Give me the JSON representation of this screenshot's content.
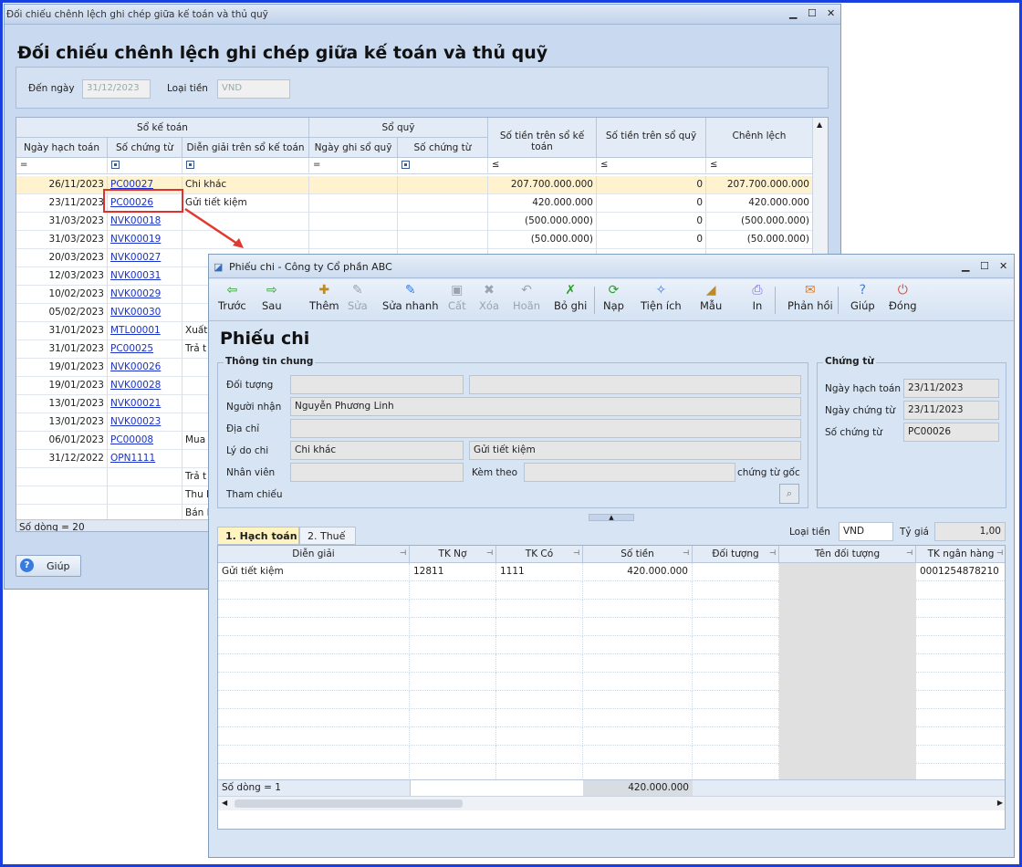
{
  "win1": {
    "title": "Đối chiếu chênh lệch ghi chép giữa kế toán và thủ quỹ",
    "heading": "Đối chiếu chênh lệch ghi chép giữa kế toán và thủ quỹ",
    "den_ngay_label": "Đến ngày",
    "den_ngay": "31/12/2023",
    "loai_tien_label": "Loại tiền",
    "loai_tien": "VND",
    "grp_so_ke_toan": "Sổ kế toán",
    "grp_so_quy": "Sổ quỹ",
    "cols": [
      "Ngày hạch toán",
      "Số chứng từ",
      "Diễn giải trên sổ kế toán",
      "Ngày ghi sổ quỹ",
      "Số chứng từ",
      "Số tiền trên sổ kế toán",
      "Số tiền trên sổ quỹ",
      "Chênh lệch"
    ],
    "filters": [
      "=",
      "□",
      "□",
      "=",
      "□",
      "≤",
      "≤",
      "≤"
    ],
    "rows": [
      [
        "26/11/2023",
        "PC00027",
        "Chi khác",
        "",
        "",
        "207.700.000.000",
        "0",
        "207.700.000.000"
      ],
      [
        "23/11/2023",
        "PC00026",
        "Gửi tiết kiệm",
        "",
        "",
        "420.000.000",
        "0",
        "420.000.000"
      ],
      [
        "31/03/2023",
        "NVK00018",
        "",
        "",
        "",
        "(500.000.000)",
        "0",
        "(500.000.000)"
      ],
      [
        "31/03/2023",
        "NVK00019",
        "",
        "",
        "",
        "(50.000.000)",
        "0",
        "(50.000.000)"
      ],
      [
        "20/03/2023",
        "NVK00027",
        "",
        "",
        "",
        "",
        "",
        ""
      ],
      [
        "12/03/2023",
        "NVK00031",
        "",
        "",
        "",
        "",
        "",
        ""
      ],
      [
        "10/02/2023",
        "NVK00029",
        "",
        "",
        "",
        "",
        "",
        ""
      ],
      [
        "05/02/2023",
        "NVK00030",
        "",
        "",
        "",
        "",
        "",
        ""
      ],
      [
        "31/01/2023",
        "MTL00001",
        "Xuất",
        "",
        "",
        "",
        "",
        ""
      ],
      [
        "31/01/2023",
        "PC00025",
        "Trả t",
        "",
        "",
        "",
        "",
        ""
      ],
      [
        "19/01/2023",
        "NVK00026",
        "",
        "",
        "",
        "",
        "",
        ""
      ],
      [
        "19/01/2023",
        "NVK00028",
        "",
        "",
        "",
        "",
        "",
        ""
      ],
      [
        "13/01/2023",
        "NVK00021",
        "",
        "",
        "",
        "",
        "",
        ""
      ],
      [
        "13/01/2023",
        "NVK00023",
        "",
        "",
        "",
        "",
        "",
        ""
      ],
      [
        "06/01/2023",
        "PC00008",
        "Mua",
        "",
        "",
        "",
        "",
        ""
      ],
      [
        "31/12/2022",
        "OPN1111",
        "",
        "",
        "",
        "",
        "",
        ""
      ],
      [
        "",
        "",
        "Trả t",
        "",
        "",
        "",
        "",
        ""
      ],
      [
        "",
        "",
        "Thu I",
        "",
        "",
        "",
        "",
        ""
      ],
      [
        "",
        "",
        "Bán I",
        "",
        "",
        "",
        "",
        ""
      ]
    ],
    "footer": "Số dòng = 20",
    "help": "Giúp"
  },
  "win2": {
    "title": "Phiếu chi - Công ty Cổ phần ABC",
    "heading": "Phiếu chi",
    "toolbar": [
      "Trước",
      "Sau",
      "Thêm",
      "Sửa",
      "Sửa nhanh",
      "Cất",
      "Xóa",
      "Hoãn",
      "Bỏ ghi",
      "Nạp",
      "Tiện ích",
      "Mẫu",
      "In",
      "Phản hồi",
      "Giúp",
      "Đóng"
    ],
    "thong_tin": "Thông tin chung",
    "doi_tuong": "Đối tượng",
    "nguoi_nhan": "Người nhận",
    "nguoi_nhan_val": "Nguyễn Phương Linh",
    "dia_chi": "Địa chỉ",
    "ly_do": "Lý do chi",
    "ly_do_val": "Chi khác",
    "ly_do_val2": "Gửi tiết kiệm",
    "nhan_vien": "Nhân viên",
    "kem_theo": "Kèm theo",
    "chung_tu_goc": "chứng từ gốc",
    "tham_chieu": "Tham chiếu",
    "chung_tu": "Chứng từ",
    "ngay_ht": "Ngày hạch toán",
    "ngay_ht_val": "23/11/2023",
    "ngay_ct": "Ngày chứng từ",
    "ngay_ct_val": "23/11/2023",
    "so_ct": "Số chứng từ",
    "so_ct_val": "PC00026",
    "tab1": "1. Hạch toán",
    "tab2": "2. Thuế",
    "loai_tien": "Loại tiền",
    "loai_tien_val": "VND",
    "ty_gia": "Tỷ giá",
    "ty_gia_val": "1,00",
    "cols": [
      "Diễn giải",
      "TK Nợ",
      "TK Có",
      "Số tiền",
      "Đối tượng",
      "Tên đối tượng",
      "TK ngân hàng"
    ],
    "row": [
      "Gửi tiết kiệm",
      "12811",
      "1111",
      "420.000.000",
      "",
      "",
      "0001254878210"
    ],
    "footer": "Số dòng = 1",
    "footer_total": "420.000.000"
  }
}
